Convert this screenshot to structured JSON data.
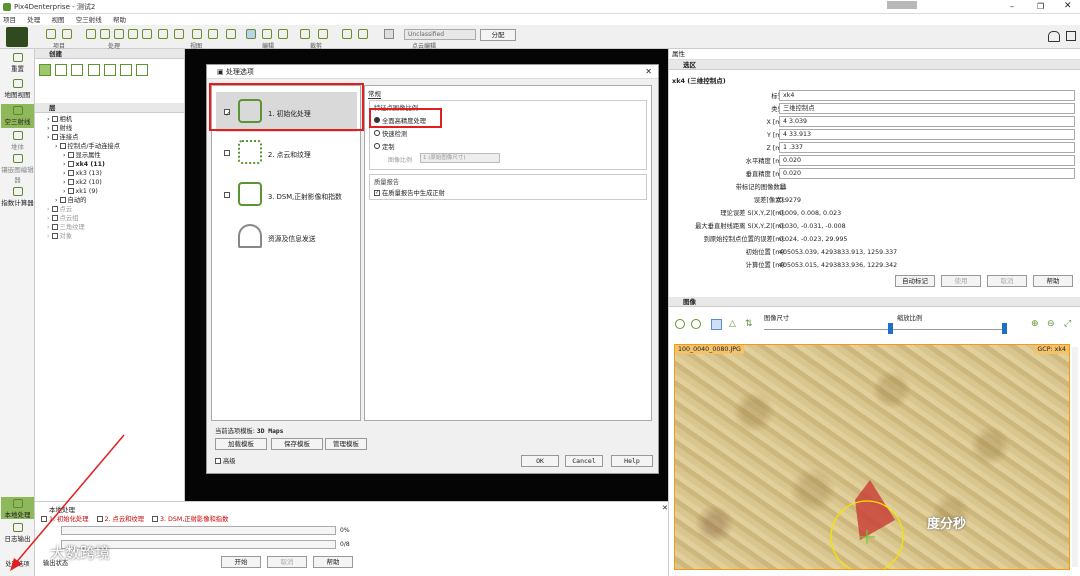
{
  "window": {
    "title": "Pix4Denterprise - 测试2"
  },
  "menu": [
    "项目",
    "处理",
    "视图",
    "空三射线",
    "帮助"
  ],
  "toolbar": {
    "groups": [
      "项目",
      "处理",
      "视图",
      "编辑",
      "裁剪",
      "点云编辑"
    ],
    "unclassified_label": "Unclassified",
    "assign_label": "分配"
  },
  "left_nav": [
    "重置",
    "地图视图",
    "空三射线",
    "堆体",
    "镶嵌图编辑器",
    "指数计算器",
    "本地处理",
    "日志输出",
    "处理选项"
  ],
  "layers_panel": {
    "create_title": "创建",
    "layers_title": "层",
    "tree": [
      {
        "label": "相机",
        "indent": 1
      },
      {
        "label": "射线",
        "indent": 1
      },
      {
        "label": "连接点",
        "indent": 1
      },
      {
        "label": "控制点/手动连接点",
        "indent": 2
      },
      {
        "label": "显示属性",
        "indent": 3
      },
      {
        "label": "xk4 (11)",
        "indent": 3,
        "bold": true
      },
      {
        "label": "xk3 (13)",
        "indent": 3
      },
      {
        "label": "xk2 (10)",
        "indent": 3
      },
      {
        "label": "xk1 (9)",
        "indent": 3
      },
      {
        "label": "自动的",
        "indent": 2
      },
      {
        "label": "点云",
        "indent": 1,
        "disabled": true
      },
      {
        "label": "点云组",
        "indent": 1,
        "disabled": true
      },
      {
        "label": "三角纹理",
        "indent": 1,
        "disabled": true
      },
      {
        "label": "对象",
        "indent": 1,
        "disabled": true
      }
    ]
  },
  "dialog": {
    "title": "处理选项",
    "steps": [
      "1. 初始化处理",
      "2. 点云和纹理",
      "3. DSM,正射影像和指数",
      "资源及信息发送"
    ],
    "tab": "常规",
    "section_scale": "特征点图像比例",
    "opt_full": "全面高精度处理",
    "opt_fast": "快速检测",
    "opt_custom": "定制",
    "image_scale_label": "图像比例",
    "image_scale_value": "1 (原始图像尺寸)",
    "section_quality": "质量报告",
    "quality_check": "在质量报告中生成正射",
    "template_label": "当前选项模板:",
    "template_value": "3D Maps",
    "btn_load": "加载模板",
    "btn_save": "保存模板",
    "btn_manage": "管理模板",
    "advanced": "高级",
    "ok": "OK",
    "cancel": "Cancel",
    "help": "Help"
  },
  "props": {
    "header": "属性",
    "selection_title": "选区",
    "point_title": "xk4 (三维控制点)",
    "rows": [
      {
        "label": "标签:",
        "value": "xk4",
        "field": true
      },
      {
        "label": "类型:",
        "value": "三维控制点",
        "field": true
      },
      {
        "label": "X [m]:",
        "value": "4     3.039",
        "field": true
      },
      {
        "label": "Y [m]:",
        "value": "4     33.913",
        "field": true
      },
      {
        "label": "Z [m]:",
        "value": "1     .337",
        "field": true
      },
      {
        "label": "水平精度 [m]:",
        "value": "0.020",
        "field": true
      },
      {
        "label": "垂直精度 [m]:",
        "value": "0.020",
        "field": true
      },
      {
        "label": "带标记的图像数量",
        "value": "11",
        "field": false
      },
      {
        "label": "误差[像素]:",
        "value": "0.9279",
        "field": false
      },
      {
        "label": "理论误差 S(X,Y,Z)[m]:",
        "value": "0.009, 0.008, 0.023",
        "field": false
      },
      {
        "label": "最大垂直射线距离 S(X,Y,Z)[m]:",
        "value": "0.030, -0.031, -0.008",
        "field": false
      },
      {
        "label": "到原始控制点位置的误差[m]:",
        "value": "0.024, -0.023, 29.995",
        "field": false
      },
      {
        "label": "初始位置 [m]:",
        "value": "405053.039, 4293833.913, 1259.337",
        "field": false
      },
      {
        "label": "计算位置 [m]:",
        "value": "405053.015, 4293833.936, 1229.342",
        "field": false
      }
    ],
    "buttons": [
      "自动标记",
      "使用",
      "取消",
      "帮助"
    ]
  },
  "images": {
    "header": "图像",
    "image_size": "图像尺寸",
    "zoom": "缩放比例",
    "filename": "100_0040_0080.JPG",
    "gcp": "GCP: xk4"
  },
  "local_processing": {
    "title": "本地处理",
    "steps": [
      "1. 初始化处理",
      "2. 点云和纹理",
      "3. DSM,正射影像和指数"
    ],
    "progress1": "0%",
    "progress2": "0/8",
    "start": "开始",
    "cancel": "取消",
    "help": "帮助",
    "output": "输出状态"
  },
  "watermark": {
    "left": "大数跨境",
    "right": "度分秒"
  }
}
